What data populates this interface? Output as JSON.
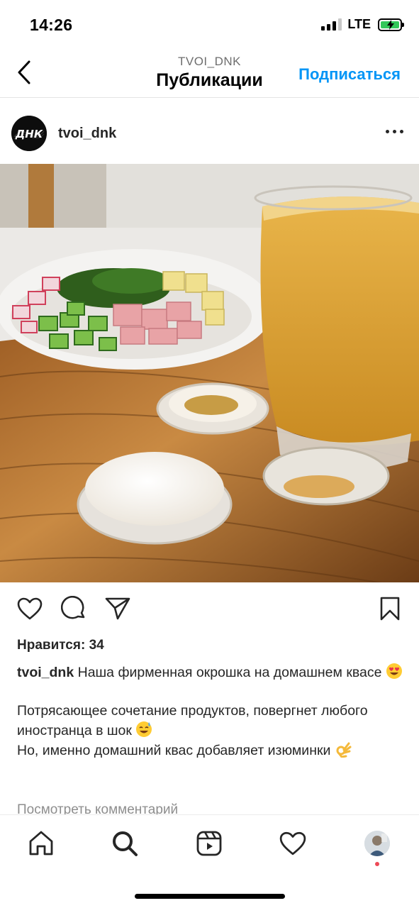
{
  "status_bar": {
    "time": "14:26",
    "network": "LTE"
  },
  "header": {
    "account": "TVOI_DNK",
    "title": "Публикации",
    "follow_label": "Подписаться"
  },
  "post": {
    "username": "tvoi_dnk",
    "avatar_text": "ДНК",
    "likes": "Нравится: 34",
    "caption": {
      "username": "tvoi_dnk",
      "line1": "Наша фирменная окрошка на домашнем квасе",
      "line2": "Потрясающее сочетание продуктов, повергнет любого иностранца в шок",
      "line3": "Но, именно домашний квас добавляет изюминки"
    },
    "view_comments": "Посмотреть комментарий"
  },
  "icons": {
    "back": "chevron-left-icon",
    "more": "more-horizontal-icon",
    "like": "heart-icon",
    "comment": "comment-icon",
    "share": "send-icon",
    "save": "bookmark-icon",
    "tab_home": "home-icon",
    "tab_search": "search-icon",
    "tab_reels": "reels-icon",
    "tab_activity": "heart-icon",
    "tab_profile": "profile-avatar"
  },
  "colors": {
    "accent": "#0095f6",
    "text": "#262626",
    "muted": "#8e8e8e",
    "battery": "#32c759",
    "notification": "#ed4956"
  }
}
